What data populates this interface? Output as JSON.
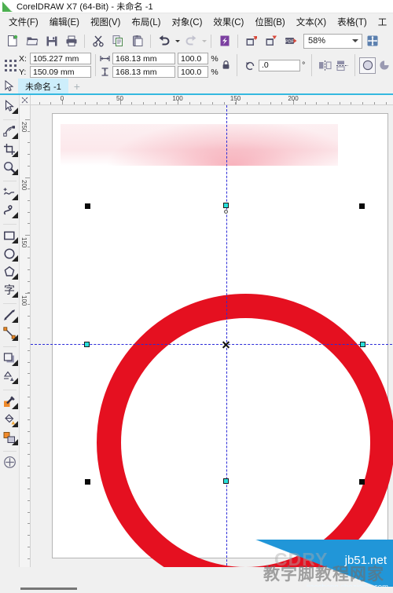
{
  "titlebar": {
    "icon": "coreldraw-logo-icon",
    "title": "CorelDRAW X7 (64-Bit) - 未命名 -1"
  },
  "menubar": {
    "items": [
      {
        "name": "menu-file",
        "label": "文件(F)"
      },
      {
        "name": "menu-edit",
        "label": "编辑(E)"
      },
      {
        "name": "menu-view",
        "label": "视图(V)"
      },
      {
        "name": "menu-layout",
        "label": "布局(L)"
      },
      {
        "name": "menu-object",
        "label": "对象(C)"
      },
      {
        "name": "menu-effects",
        "label": "效果(C)"
      },
      {
        "name": "menu-bitmap",
        "label": "位图(B)"
      },
      {
        "name": "menu-text",
        "label": "文本(X)"
      },
      {
        "name": "menu-table",
        "label": "表格(T)"
      },
      {
        "name": "menu-tools",
        "label": "工"
      }
    ]
  },
  "standard_toolbar": {
    "buttons": [
      {
        "name": "new-document-button",
        "icon": "new-document-icon"
      },
      {
        "name": "open-document-button",
        "icon": "open-folder-icon"
      },
      {
        "name": "save-document-button",
        "icon": "floppy-save-icon"
      },
      {
        "name": "print-button",
        "icon": "printer-icon"
      },
      {
        "name": "cut-button",
        "icon": "scissors-icon"
      },
      {
        "name": "copy-button",
        "icon": "copy-icon"
      },
      {
        "name": "paste-button",
        "icon": "clipboard-paste-icon"
      },
      {
        "name": "undo-button",
        "icon": "undo-arrow-icon"
      },
      {
        "name": "redo-button",
        "icon": "redo-arrow-icon"
      },
      {
        "name": "corel-connect-button",
        "icon": "corel-connect-icon"
      },
      {
        "name": "import-button",
        "icon": "import-icon"
      },
      {
        "name": "export-button",
        "icon": "export-icon"
      },
      {
        "name": "publish-pdf-button",
        "icon": "pdf-export-icon"
      },
      {
        "name": "options-button",
        "icon": "options-grid-icon"
      }
    ],
    "zoom_level": "58%"
  },
  "property_bar": {
    "object_origin_icon": "object-origin-grid-icon",
    "position": {
      "x_label": "X:",
      "x_value": "105.227 mm",
      "y_label": "Y:",
      "y_value": "150.09 mm"
    },
    "size": {
      "width_icon": "width-arrows-icon",
      "width_value": "168.13 mm",
      "height_icon": "height-arrows-icon",
      "height_value": "168.13 mm"
    },
    "scale": {
      "width_percent": "100.0",
      "height_percent": "100.0",
      "unit": "%"
    },
    "lock_ratio_icon": "lock-closed-icon",
    "rotation": {
      "icon": "rotation-arrow-icon",
      "value": ".0",
      "unit": "°"
    },
    "mirror": {
      "horizontal_icon": "mirror-horizontal-icon",
      "vertical_icon": "mirror-vertical-icon"
    },
    "shape_mode": {
      "ellipse_icon": "ellipse-icon",
      "pie_icon": "pie-slice-icon"
    }
  },
  "tabbar": {
    "picker_icon": "cursor-arrow-icon",
    "document_tab": "未命名 -1",
    "new_tab_label": "+"
  },
  "toolbox": {
    "tools": [
      {
        "name": "tool-pick",
        "icon": "cursor-arrow-icon",
        "selected": false
      },
      {
        "name": "tool-shape",
        "icon": "shape-node-icon",
        "selected": false
      },
      {
        "name": "tool-crop",
        "icon": "crop-icon",
        "selected": false
      },
      {
        "name": "tool-zoom",
        "icon": "magnifier-icon",
        "selected": false
      },
      {
        "name": "tool-freehand",
        "icon": "freehand-curve-icon",
        "selected": false
      },
      {
        "name": "tool-artistic-media",
        "icon": "artistic-media-icon",
        "selected": false
      },
      {
        "name": "tool-rectangle",
        "icon": "rectangle-icon",
        "selected": false
      },
      {
        "name": "tool-ellipse",
        "icon": "ellipse-icon",
        "selected": false
      },
      {
        "name": "tool-polygon",
        "icon": "polygon-icon",
        "selected": false
      },
      {
        "name": "tool-text",
        "icon": "text-zi-icon",
        "selected": false
      },
      {
        "name": "tool-dimension",
        "icon": "dimension-icon",
        "selected": false
      },
      {
        "name": "tool-connector",
        "icon": "connector-line-icon",
        "selected": false
      },
      {
        "name": "tool-shadow",
        "icon": "drop-shadow-icon",
        "selected": false
      },
      {
        "name": "tool-transparency",
        "icon": "transparency-icon",
        "selected": false
      },
      {
        "name": "tool-color-eyedropper",
        "icon": "eyedropper-icon",
        "selected": false
      },
      {
        "name": "tool-fill",
        "icon": "paint-bucket-icon",
        "selected": false
      },
      {
        "name": "tool-interactive-fill",
        "icon": "interactive-fill-icon",
        "selected": false
      },
      {
        "name": "tool-smart-fill",
        "icon": "plus-circle-icon",
        "selected": false
      }
    ]
  },
  "rulers": {
    "unit": "mm",
    "horizontal_labels": [
      "0",
      "50",
      "100",
      "150",
      "200"
    ],
    "vertical_labels": [
      "250",
      "200",
      "150",
      "100"
    ]
  },
  "canvas": {
    "page": {
      "name": "drawing-page"
    },
    "objects": [
      {
        "name": "gradient-band",
        "type": "rectangle",
        "fill": "pink-gradient"
      },
      {
        "name": "red-ring",
        "type": "ellipse",
        "stroke_color": "#e51020",
        "selected": true
      }
    ],
    "guides": {
      "color": "#2b2bd8",
      "vertical_count": 1,
      "horizontal_count": 1
    },
    "selection": {
      "handle_color": "#0a0a0a",
      "mid_handle_color": "#29e0dc"
    }
  },
  "watermark": {
    "ghost_text": "CDRY",
    "chinese_text": "教字脚教程网家",
    "site": "jb51.net",
    "url": "jiaocheng.chezidian.com"
  }
}
